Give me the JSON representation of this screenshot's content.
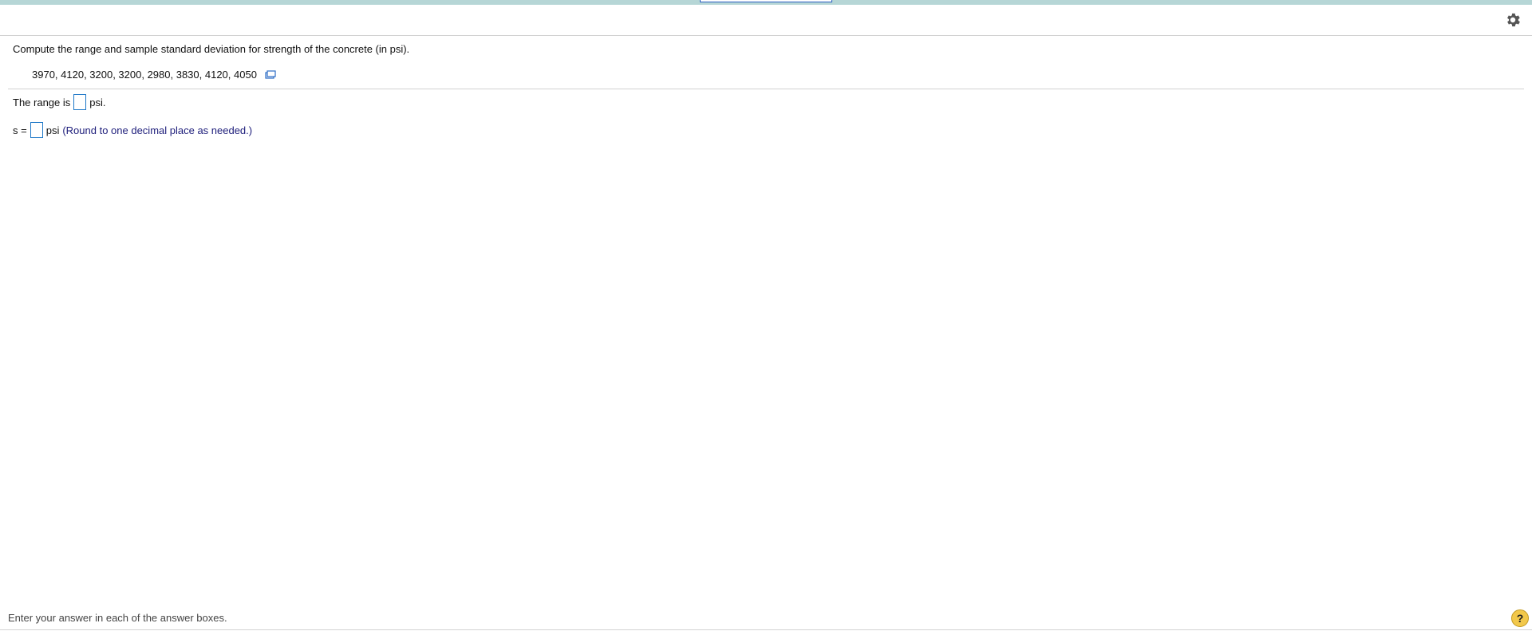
{
  "header": {
    "settings_icon": "gear-icon"
  },
  "question": {
    "prompt": "Compute the range and sample standard deviation for strength of the concrete (in psi).",
    "data_values": "3970, 4120, 3200, 3200, 2980, 3830, 4120, 4050",
    "copy_icon": "copy-data-icon"
  },
  "answers": {
    "range_prefix": "The range is",
    "range_suffix": "psi.",
    "range_value": "",
    "sd_prefix": "s =",
    "sd_suffix": "psi",
    "sd_hint": "(Round to one decimal place as needed.)",
    "sd_value": ""
  },
  "footer": {
    "instruction": "Enter your answer in each of the answer boxes.",
    "help_label": "?"
  },
  "colors": {
    "top_strip": "#b6d6d6",
    "answer_box_border": "#1f78c8",
    "hint_text": "#1c1c7a",
    "help_button": "#f2c84b"
  }
}
